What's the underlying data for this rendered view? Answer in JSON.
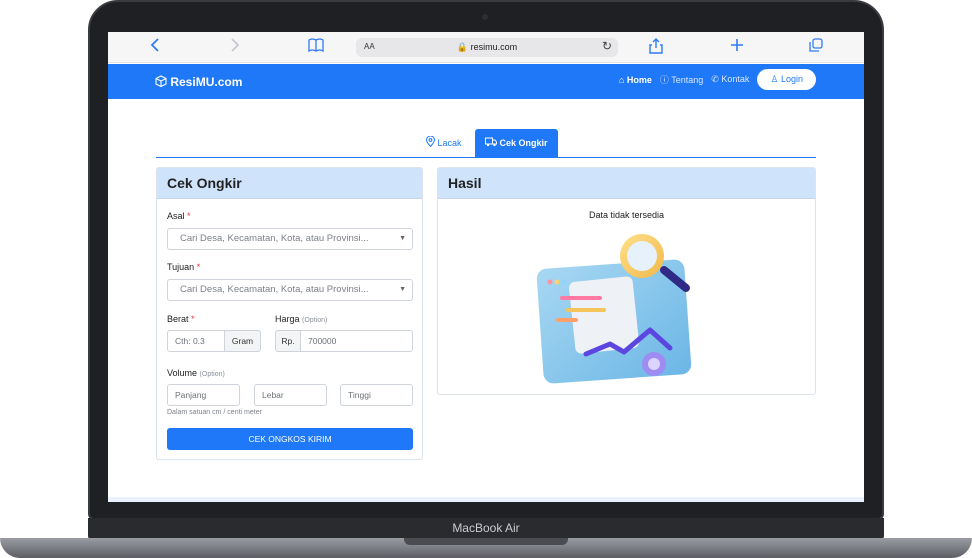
{
  "device": {
    "label": "MacBook Air"
  },
  "browser": {
    "text_size_label": "AA",
    "url": "resimu.com"
  },
  "navbar": {
    "brand": "ResiMU.com",
    "links": [
      {
        "label": "Home",
        "icon": "home-icon",
        "active": true
      },
      {
        "label": "Tentang",
        "icon": "info-icon",
        "active": false
      },
      {
        "label": "Kontak",
        "icon": "phone-icon",
        "active": false
      }
    ],
    "login_label": "Login"
  },
  "tabs": [
    {
      "label": "Lacak",
      "icon": "location-pin-icon",
      "active": false
    },
    {
      "label": "Cek Ongkir",
      "icon": "truck-icon",
      "active": true
    }
  ],
  "form": {
    "title": "Cek Ongkir",
    "asal_label": "Asal",
    "asal_placeholder": "Cari Desa, Kecamatan, Kota, atau Provinsi...",
    "tujuan_label": "Tujuan",
    "tujuan_placeholder": "Cari Desa, Kecamatan, Kota, atau Provinsi...",
    "required_mark": "*",
    "berat_label": "Berat",
    "berat_placeholder": "Cth: 0.3",
    "berat_unit": "Gram",
    "harga_label": "Harga",
    "harga_option": "(Option)",
    "harga_prefix": "Rp.",
    "harga_placeholder": "700000",
    "volume_label": "Volume",
    "volume_option": "(Option)",
    "panjang_placeholder": "Panjang",
    "lebar_placeholder": "Lebar",
    "tinggi_placeholder": "Tinggi",
    "volume_help": "Dalam satuan cm / centi meter",
    "submit_label": "CEK ONGKOS KIRIM"
  },
  "result": {
    "title": "Hasil",
    "empty_message": "Data tidak tersedia"
  },
  "colors": {
    "primary": "#1e78f7",
    "card_header": "#cfe4fb",
    "required": "#e23b3b"
  }
}
